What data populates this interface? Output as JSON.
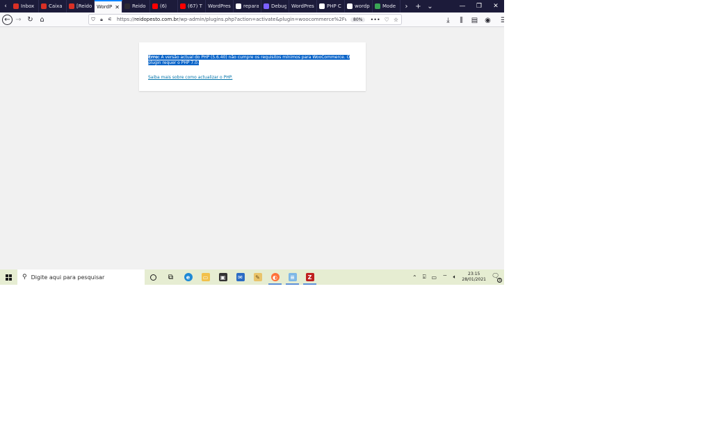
{
  "browser": {
    "tabs": [
      {
        "label": "Inbox",
        "favicon": "gmail-icon",
        "color": "#d93025",
        "active": false
      },
      {
        "label": "Caixa",
        "favicon": "gmail-icon",
        "color": "#d93025",
        "active": false
      },
      {
        "label": "[Reido",
        "favicon": "gmail-icon",
        "color": "#d93025",
        "active": false
      },
      {
        "label": "WordP",
        "favicon": "none",
        "color": "",
        "active": true
      },
      {
        "label": "Reido",
        "favicon": "wp-icon",
        "color": "#2b2a33",
        "active": false
      },
      {
        "label": "(6)",
        "favicon": "youtube-icon",
        "color": "#ff0000",
        "active": false
      },
      {
        "label": "(67) T",
        "favicon": "youtube-icon",
        "color": "#ff0000",
        "active": false
      },
      {
        "label": "WordPres",
        "favicon": "none",
        "color": "",
        "active": false
      },
      {
        "label": "repara",
        "favicon": "google-icon",
        "color": "#ffffff",
        "active": false
      },
      {
        "label": "Debug",
        "favicon": "debug-icon",
        "color": "#7b61ff",
        "active": false
      },
      {
        "label": "WordPres",
        "favicon": "none",
        "color": "",
        "active": false
      },
      {
        "label": "PHP C",
        "favicon": "wp-icon",
        "color": "#ffffff",
        "active": false
      },
      {
        "label": "wordp",
        "favicon": "google-icon",
        "color": "#ffffff",
        "active": false
      },
      {
        "label": "Mode",
        "favicon": "site-icon",
        "color": "#3aa655",
        "active": false
      }
    ],
    "url": {
      "scheme": "https://",
      "host": "reidopesto.com.br",
      "path": "/wp-admin/plugins.php?action=activate&plugin=woocommerce%2Fwooco"
    },
    "zoom": "80%"
  },
  "page": {
    "error_label": "Erro:",
    "error_message": " A versão actual do PHP (5.6.40) não cumpre os requisitos mínimos para WooCommerce. O plugin requer o PHP 7.0.",
    "help_link": "Saiba mais sobre como actualizar o PHP."
  },
  "taskbar": {
    "search_placeholder": "Digite aqui para pesquisar",
    "time": "23:15",
    "date": "28/01/2021",
    "notification_count": "3"
  }
}
